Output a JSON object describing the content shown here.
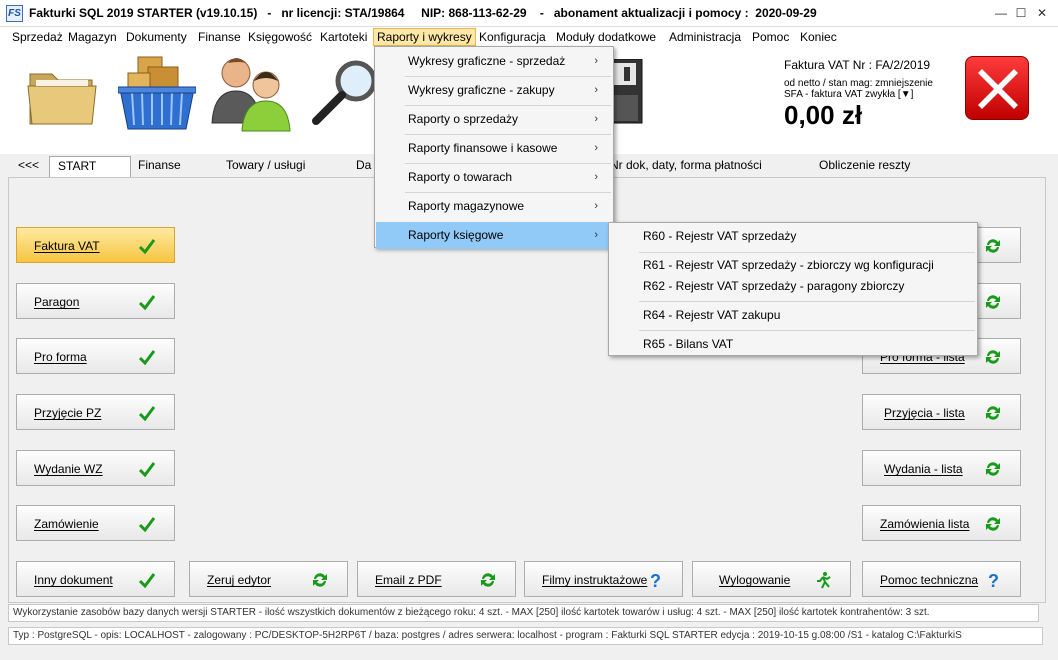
{
  "window": {
    "app_icon_text": "FS",
    "title": "Fakturki SQL 2019 STARTER (v19.10.15)   -   nr licencji: STA/19864     NIP: 868-113-62-29    -   abonament aktualizacji i pomocy :  2020-09-29",
    "min_glyph": "—",
    "max_glyph": "☐",
    "close_glyph": "✕"
  },
  "menubar": [
    "Sprzedaż",
    "Magazyn",
    "Dokumenty",
    "Finanse",
    "Księgowość",
    "Kartoteki",
    "Raporty i wykresy",
    "Konfiguracja",
    "Moduły dodatkowe",
    "Administracja",
    "Pomoc",
    "Koniec"
  ],
  "invoice": {
    "title": "Faktura VAT Nr :  FA/2/2019",
    "line1": "od netto / stan mag: zmniejszenie",
    "line2": "SFA - faktura VAT zwykła [▼]",
    "amount": "0,00 zł"
  },
  "tabs": {
    "back": "<<<",
    "start": "START",
    "finanse": "Finanse",
    "towary": "Towary  / usługi",
    "da": "Da",
    "nr_dok": "Nr dok, daty, forma płatności",
    "obliczenie": "Obliczenie reszty"
  },
  "left_buttons": [
    "Faktura VAT",
    "Paragon",
    "Pro forma",
    "Przyjęcie PZ",
    "Wydanie WZ",
    "Zamówienie",
    "Inny dokument"
  ],
  "bottom_buttons": {
    "zeruj": "Zeruj edytor",
    "email": "Email z PDF",
    "filmy": "Filmy instruktażowe",
    "wylogowanie": "Wylogowanie",
    "pomoc": "Pomoc techniczna"
  },
  "right_buttons": {
    "pro_forma_lista": "Pro forma - lista",
    "przyjecia_lista": "Przyjęcia - lista",
    "wydania_lista": "Wydania - lista",
    "zamowienia_lista": "Zamówienia lista"
  },
  "dropdown": {
    "items": [
      "Wykresy graficzne - sprzedaż",
      "Wykresy graficzne - zakupy",
      "Raporty o sprzedaży",
      "Raporty finansowe i kasowe",
      "Raporty o towarach",
      "Raporty magazynowe",
      "Raporty księgowe"
    ],
    "arrow": "›"
  },
  "submenu": {
    "items": [
      "R60 - Rejestr VAT sprzedaży",
      "R61 - Rejestr VAT sprzedaży - zbiorczy wg konfiguracji",
      "R62 - Rejestr VAT sprzedaży - paragony zbiorczy",
      "R64 - Rejestr VAT zakupu",
      "R65 - Bilans VAT"
    ]
  },
  "status1": "Wykorzystanie zasobów bazy danych wersji STARTER  -  ilość wszystkich dokumentów z bieżącego roku: 4 szt. - MAX [250]     ilość kartotek towarów i usług: 4 szt. - MAX [250]     ilość kartotek kontrahentów: 3 szt.",
  "status2": "Typ : PostgreSQL - opis: LOCALHOST  -  zalogowany : PC/DESKTOP-5H2RP6T  / baza: postgres / adres serwera: localhost  -  program :  Fakturki SQL STARTER edycja : 2019-10-15 g.08:00 /S1 - katalog C:\\FakturkiS",
  "colors": {
    "accent_menu": "#ffe8a6",
    "hover_blue": "#91c9f7",
    "check_green": "#1a9a1a",
    "help_blue": "#1c6fd6",
    "close_red": "#d10000"
  }
}
